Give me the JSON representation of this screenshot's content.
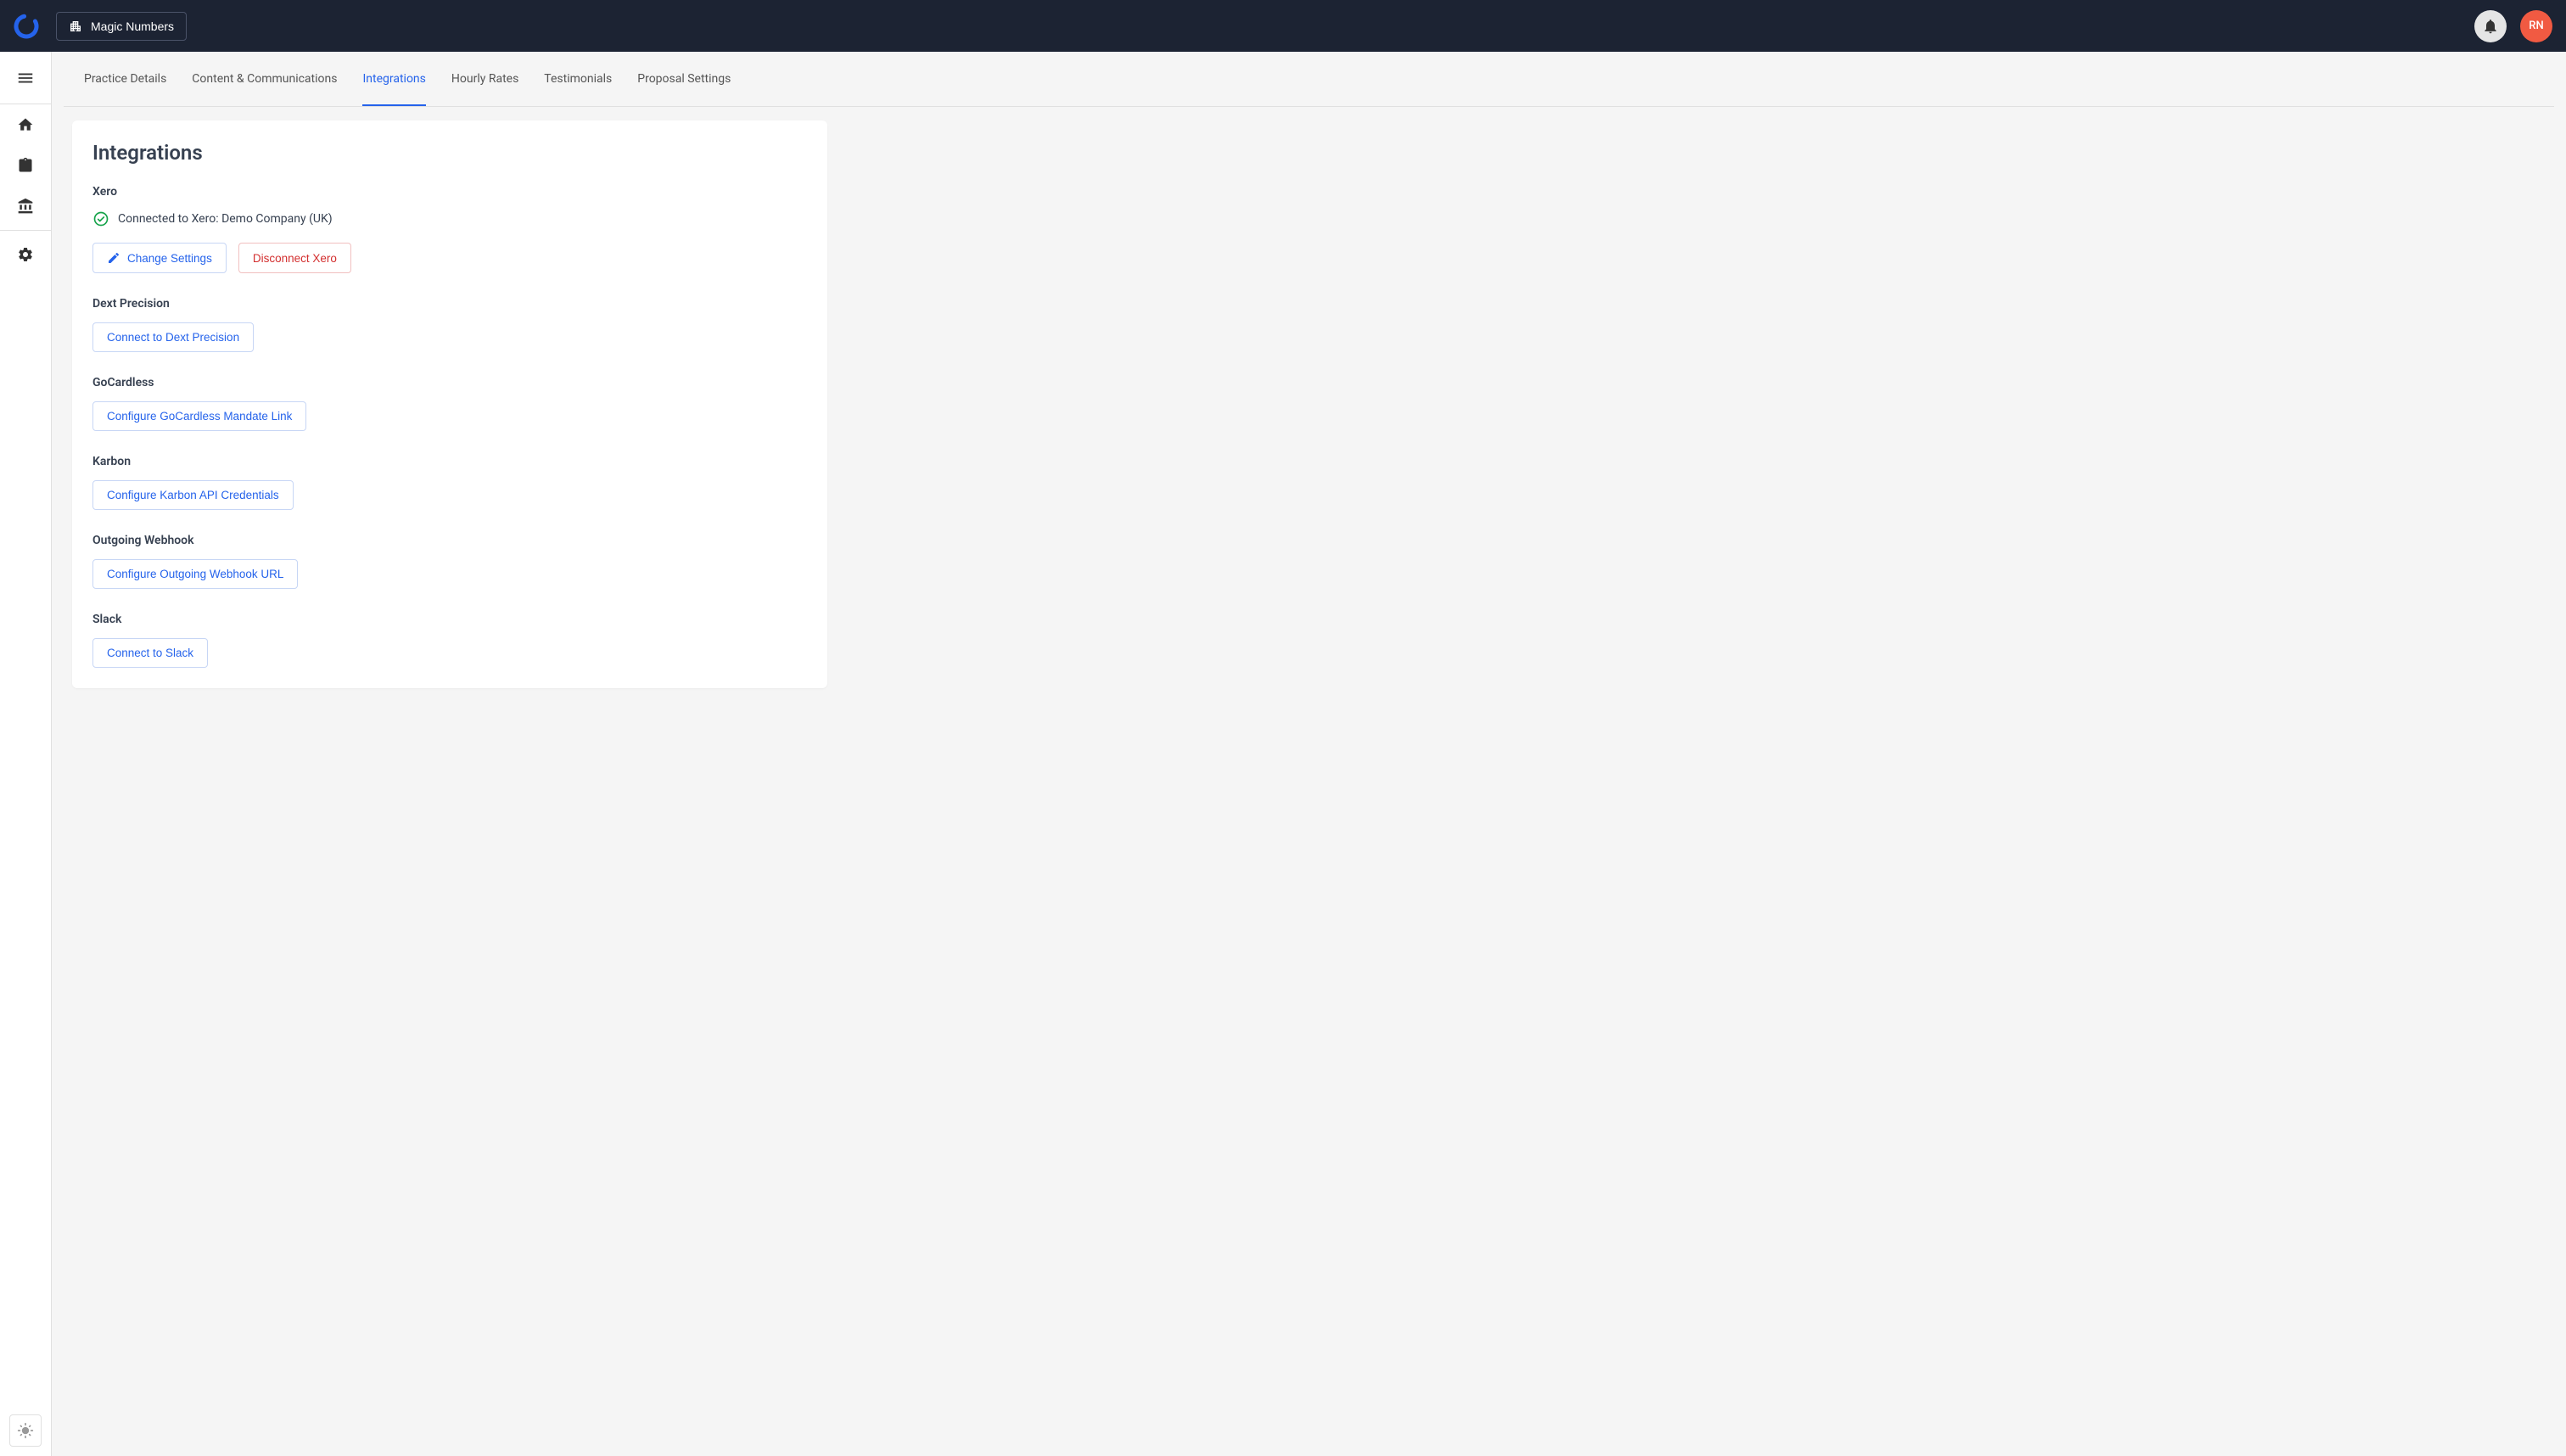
{
  "header": {
    "workspace_label": "Magic Numbers",
    "avatar_initials": "RN"
  },
  "tabs": [
    {
      "label": "Practice Details"
    },
    {
      "label": "Content & Communications"
    },
    {
      "label": "Integrations"
    },
    {
      "label": "Hourly Rates"
    },
    {
      "label": "Testimonials"
    },
    {
      "label": "Proposal Settings"
    }
  ],
  "page": {
    "title": "Integrations",
    "xero": {
      "title": "Xero",
      "status": "Connected to Xero: Demo Company (UK)",
      "change_btn": "Change Settings",
      "disconnect_btn": "Disconnect Xero"
    },
    "dext": {
      "title": "Dext Precision",
      "btn": "Connect to Dext Precision"
    },
    "gocardless": {
      "title": "GoCardless",
      "btn": "Configure GoCardless Mandate Link"
    },
    "karbon": {
      "title": "Karbon",
      "btn": "Configure Karbon API Credentials"
    },
    "webhook": {
      "title": "Outgoing Webhook",
      "btn": "Configure Outgoing Webhook URL"
    },
    "slack": {
      "title": "Slack",
      "btn": "Connect to Slack"
    }
  }
}
